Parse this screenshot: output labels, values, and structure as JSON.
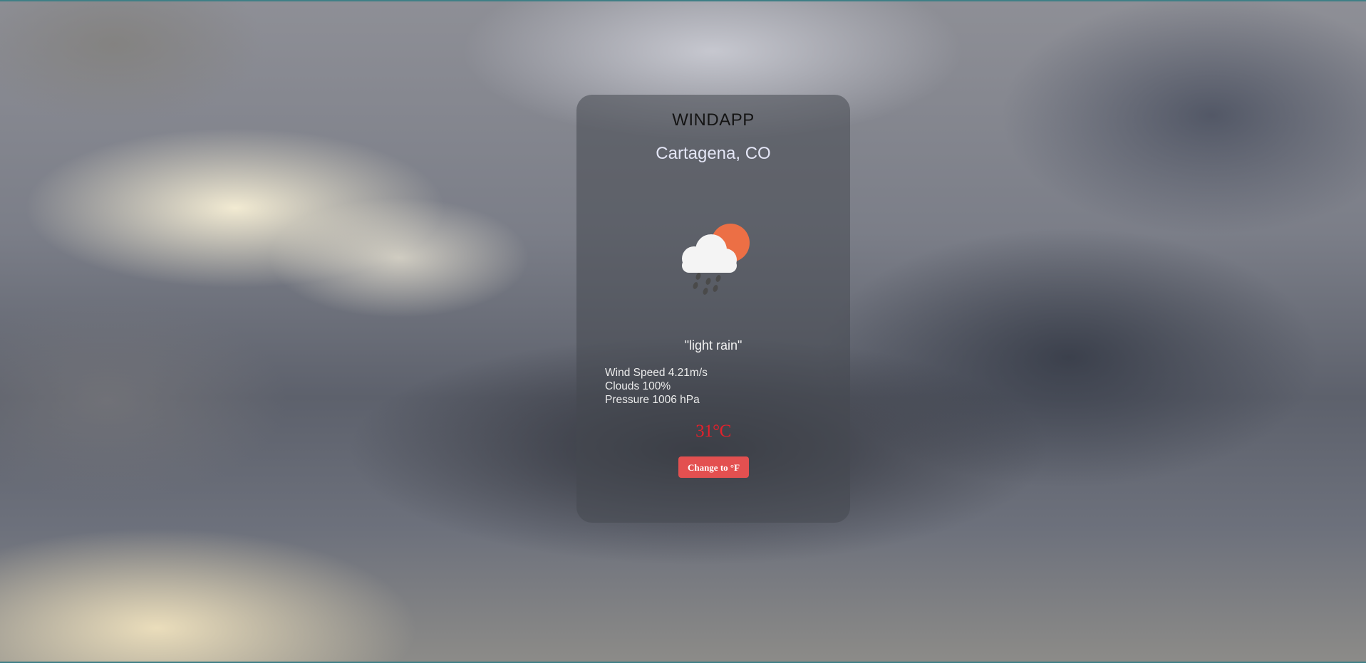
{
  "app": {
    "title": "WINDAPP"
  },
  "location": {
    "city": "Cartagena, CO"
  },
  "weather": {
    "icon": "cloud-sun-rain-icon",
    "description": "\"light rain\"",
    "wind_speed": "Wind Speed 4.21m/s",
    "clouds": "Clouds 100%",
    "pressure": "Pressure 1006 hPa",
    "temperature": "31°C"
  },
  "controls": {
    "unit_button_label": "Change to °F"
  },
  "colors": {
    "temperature": "#e5202b",
    "button": "#e35050",
    "sun": "#ec6f45"
  }
}
